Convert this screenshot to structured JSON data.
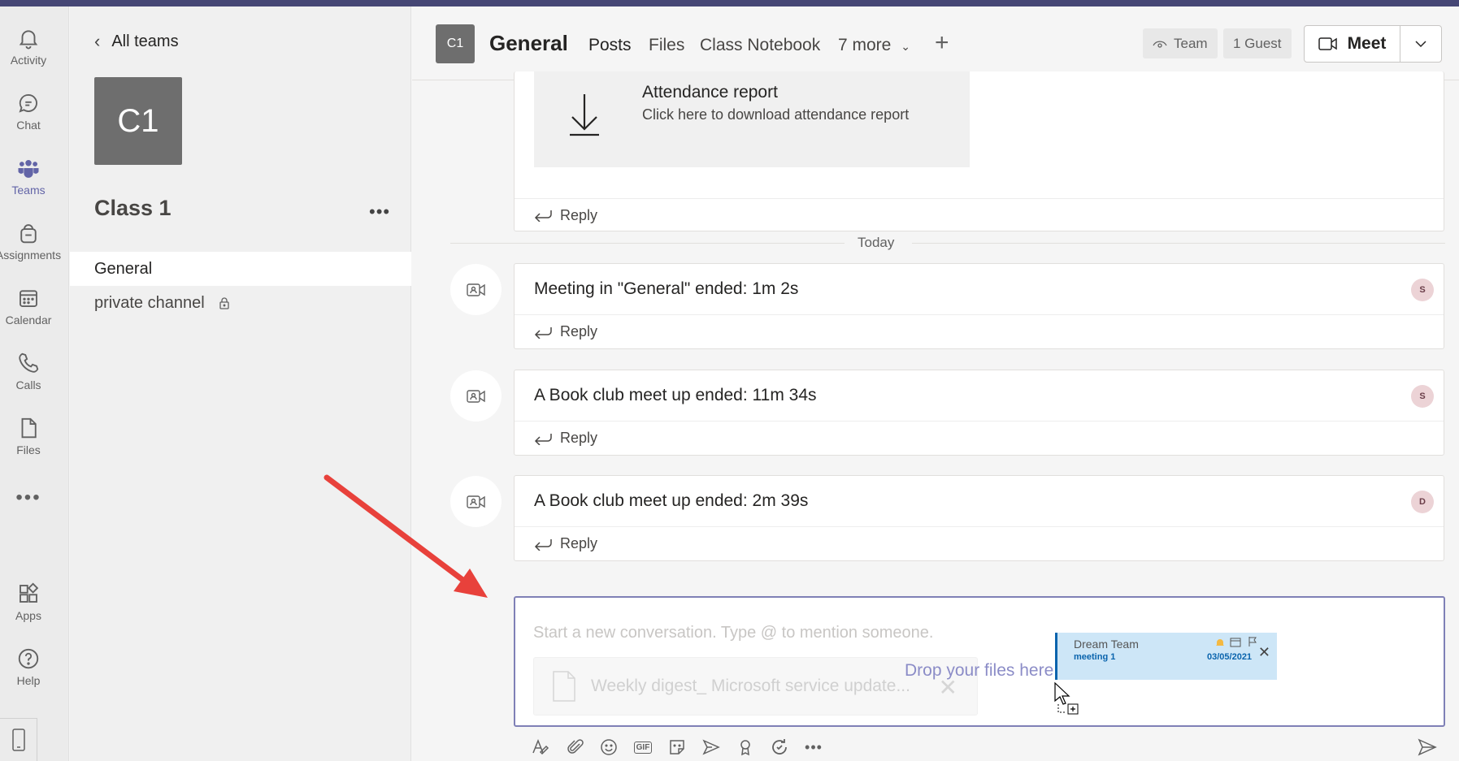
{
  "rail": {
    "items": [
      {
        "label": "Activity",
        "icon": "bell-icon"
      },
      {
        "label": "Chat",
        "icon": "chat-icon"
      },
      {
        "label": "Teams",
        "icon": "teams-icon",
        "active": true
      },
      {
        "label": "Assignments",
        "icon": "assignments-icon"
      },
      {
        "label": "Calendar",
        "icon": "calendar-icon"
      },
      {
        "label": "Calls",
        "icon": "phone-icon"
      },
      {
        "label": "Files",
        "icon": "file-icon"
      },
      {
        "label": "",
        "icon": "more-icon"
      },
      {
        "label": "Apps",
        "icon": "apps-icon"
      },
      {
        "label": "Help",
        "icon": "help-icon"
      }
    ]
  },
  "sidebar": {
    "back_label": "All teams",
    "team_avatar": "C1",
    "team_name": "Class 1",
    "channels": [
      {
        "label": "General",
        "active": true
      },
      {
        "label": "private channel",
        "locked": true
      }
    ]
  },
  "header": {
    "avatar": "C1",
    "title": "General",
    "tabs": [
      "Posts",
      "Files",
      "Class Notebook",
      "7 more"
    ],
    "team_pill": "Team",
    "guest_pill": "1 Guest",
    "meet_label": "Meet"
  },
  "feed": {
    "attachment": {
      "title": "Attendance report",
      "subtitle": "Click here to download attendance report"
    },
    "reply_label": "Reply",
    "divider": "Today",
    "messages": [
      {
        "text": "Meeting in \"General\" ended: 1m 2s",
        "user": "S"
      },
      {
        "text": "A Book club meet up ended: 11m 34s",
        "user": "S"
      },
      {
        "text": "A Book club meet up ended: 2m 39s",
        "user": "D"
      }
    ]
  },
  "compose": {
    "placeholder": "Start a new conversation. Type @ to mention someone.",
    "ghost_file": "Weekly digest_ Microsoft service update...",
    "drop_text": "Drop your files here",
    "email": {
      "from": "Dream Team",
      "subject": "meeting 1",
      "date": "03/05/2021"
    }
  },
  "colors": {
    "brand": "#6264a7",
    "topbar": "#464775",
    "arrow": "#e8413b"
  }
}
